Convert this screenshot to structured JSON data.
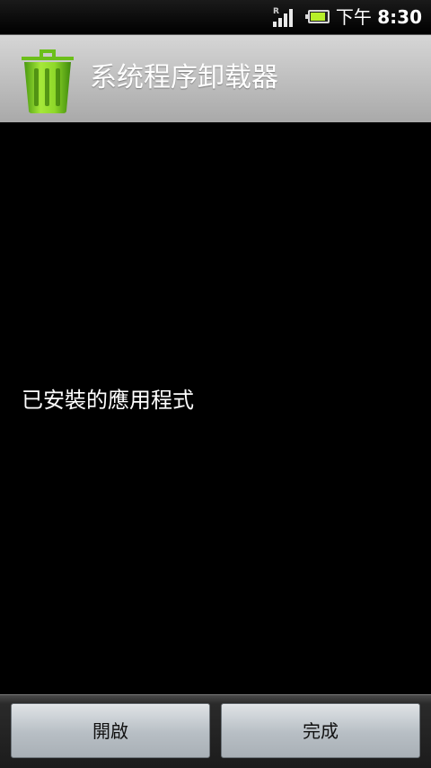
{
  "status_bar": {
    "signal_indicator": "R",
    "time_prefix": "下午",
    "time": "8:30",
    "battery_level": 0.9,
    "battery_color": "#b7ef2a"
  },
  "header": {
    "icon": "trash-can-icon",
    "icon_color": "#7ccf1f",
    "title": "系统程序卸载器"
  },
  "main": {
    "section_label": "已安裝的應用程式"
  },
  "footer": {
    "open_label": "開啟",
    "done_label": "完成"
  }
}
